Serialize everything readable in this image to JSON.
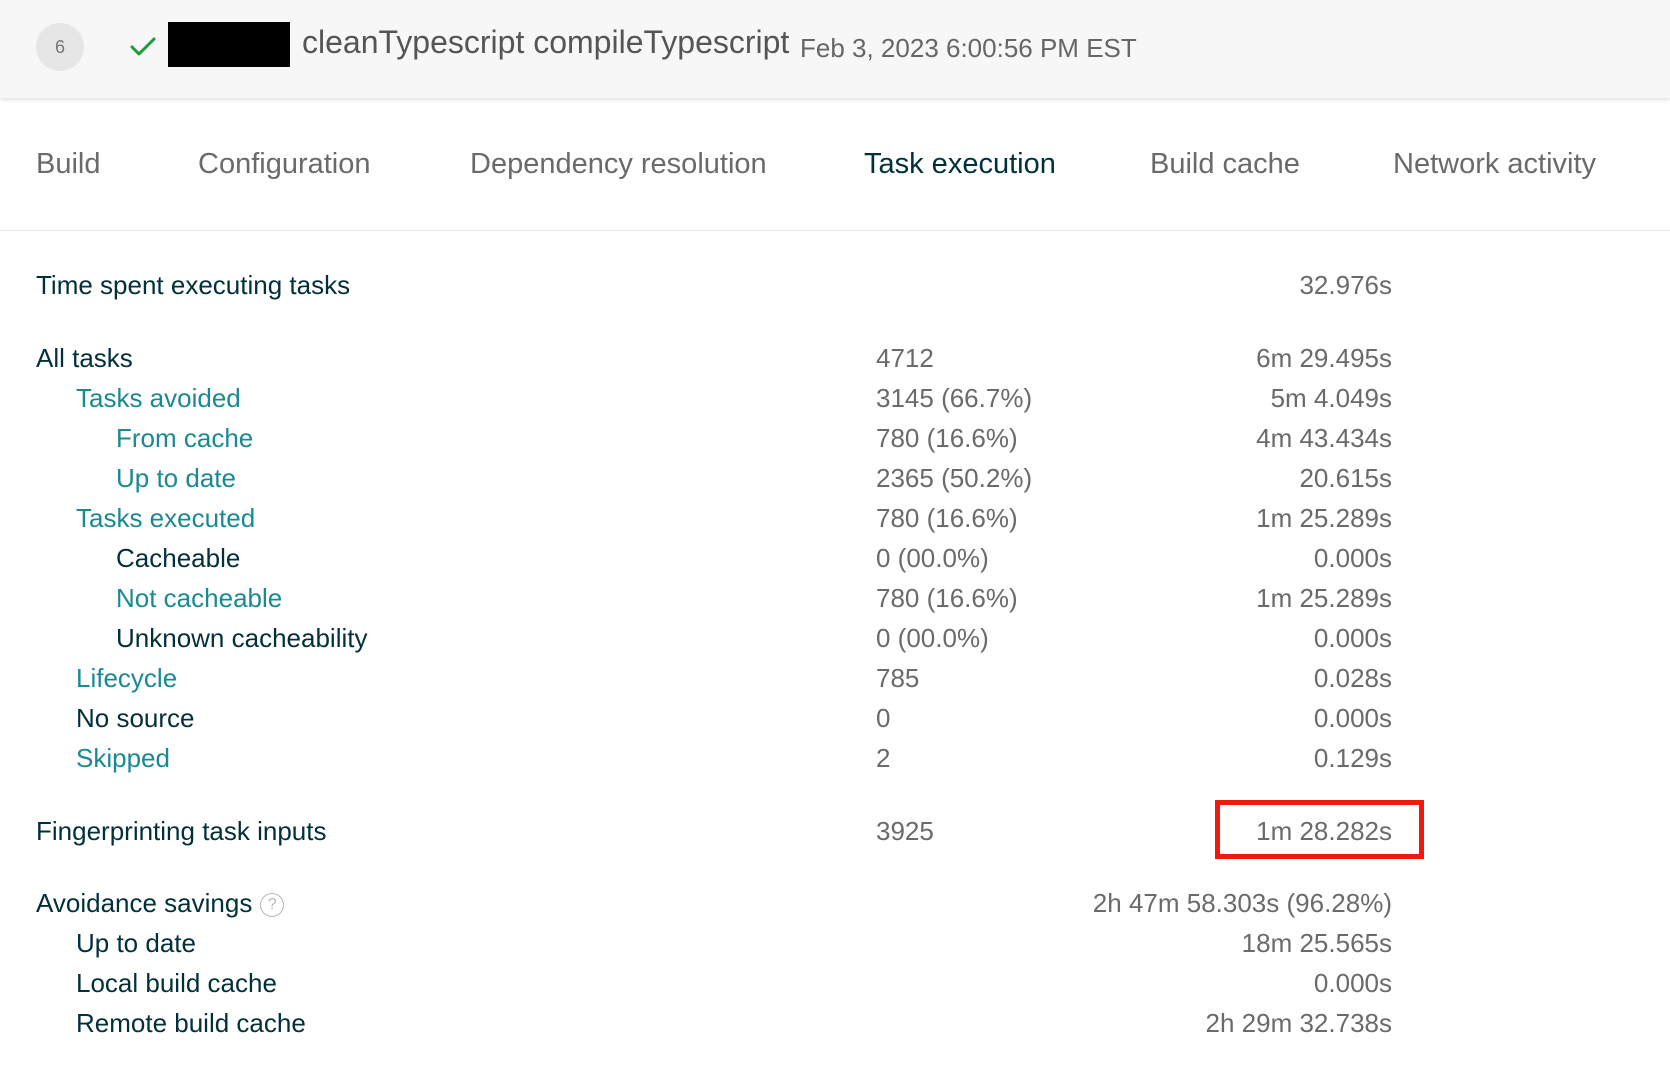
{
  "header": {
    "build_number": "6",
    "status_icon": "check-icon",
    "status_color": "#1a9c3a",
    "title": "cleanTypescript compileTypescript",
    "timestamp": "Feb 3, 2023 6:00:56 PM EST"
  },
  "tabs": [
    {
      "label": "Build",
      "active": false
    },
    {
      "label": "Configuration",
      "active": false
    },
    {
      "label": "Dependency resolution",
      "active": false
    },
    {
      "label": "Task execution",
      "active": true
    },
    {
      "label": "Build cache",
      "active": false
    },
    {
      "label": "Network activity",
      "active": false
    }
  ],
  "summary": {
    "time_spent_label": "Time spent executing tasks",
    "time_spent_value": "32.976s"
  },
  "tasks": [
    {
      "label": "All tasks",
      "count": "4712",
      "duration": "6m 29.495s",
      "link": false
    },
    {
      "label": "Tasks avoided",
      "count": "3145 (66.7%)",
      "duration": "5m 4.049s",
      "link": true
    },
    {
      "label": "From cache",
      "count": "780 (16.6%)",
      "duration": "4m 43.434s",
      "link": true
    },
    {
      "label": "Up to date",
      "count": "2365 (50.2%)",
      "duration": "20.615s",
      "link": true
    },
    {
      "label": "Tasks executed",
      "count": "780 (16.6%)",
      "duration": "1m 25.289s",
      "link": true
    },
    {
      "label": "Cacheable",
      "count": "0 (00.0%)",
      "duration": "0.000s",
      "link": false
    },
    {
      "label": "Not cacheable",
      "count": "780 (16.6%)",
      "duration": "1m 25.289s",
      "link": true
    },
    {
      "label": "Unknown cacheability",
      "count": "0 (00.0%)",
      "duration": "0.000s",
      "link": false
    },
    {
      "label": "Lifecycle",
      "count": "785",
      "duration": "0.028s",
      "link": true
    },
    {
      "label": "No source",
      "count": "0",
      "duration": "0.000s",
      "link": false
    },
    {
      "label": "Skipped",
      "count": "2",
      "duration": "0.129s",
      "link": true
    }
  ],
  "fingerprinting": {
    "label": "Fingerprinting task inputs",
    "count": "3925",
    "duration": "1m 28.282s",
    "highlight_color": "#ee1b0a"
  },
  "avoidance": {
    "label": "Avoidance savings",
    "help_icon": "question-circle-icon",
    "help_glyph": "?",
    "total": "2h 47m 58.303s (96.28%)",
    "items": [
      {
        "label": "Up to date",
        "duration": "18m 25.565s"
      },
      {
        "label": "Local build cache",
        "duration": "0.000s"
      },
      {
        "label": "Remote build cache",
        "duration": "2h 29m 32.738s"
      }
    ]
  },
  "colors": {
    "link": "#1a8a92",
    "text": "#02303a",
    "muted": "#6a6a6a"
  }
}
